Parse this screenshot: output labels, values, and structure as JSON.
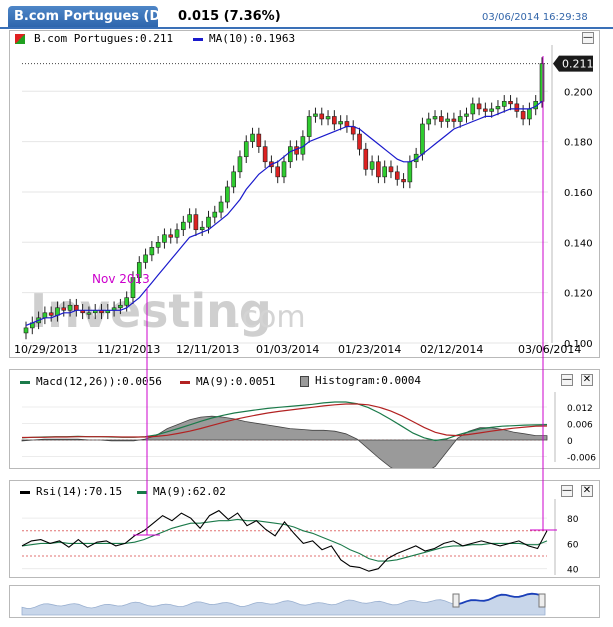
{
  "header": {
    "title": "B.com Portugues (Di...",
    "price_change": "0.015 (7.36%)",
    "timestamp": "03/06/2014 16:29:38"
  },
  "main_legend": {
    "price_label": "B.com Portugues:0.211",
    "ma_label": "MA(10):0.1963",
    "price_color": "#22aa22",
    "ma_color": "#1a1acc"
  },
  "last_price_tag": "0.211",
  "annotation": "Nov 2013",
  "watermark": {
    "brand": "Investing",
    "suffix": ".com"
  },
  "macd_legend": {
    "macd_label": "Macd(12,26)):0.0056",
    "ma_label": "MA(9):0.0051",
    "hist_label": "Histogram:0.0004",
    "macd_color": "#1b7a4a",
    "ma_color": "#b22222"
  },
  "rsi_legend": {
    "rsi_label": "Rsi(14):70.15",
    "ma_label": "MA(9):62.02",
    "rsi_color": "#000000",
    "ma_color": "#1b7a4a"
  },
  "controls": {
    "minimize": "—",
    "close": "✕"
  },
  "chart_data": [
    {
      "type": "candlestick",
      "title": "B.com Portugues",
      "x": [
        "10/29/2013",
        "11/21/2013",
        "12/11/2013",
        "01/03/2014",
        "01/23/2014",
        "02/12/2014",
        "03/06/2014"
      ],
      "y_ticks": [
        "0.100",
        "0.120",
        "0.140",
        "0.160",
        "0.180",
        "0.200"
      ],
      "ylim": [
        0.1,
        0.216
      ],
      "grid": "horizontal",
      "close": [
        0.106,
        0.108,
        0.11,
        0.112,
        0.111,
        0.114,
        0.113,
        0.115,
        0.113,
        0.112,
        0.112,
        0.113,
        0.112,
        0.113,
        0.114,
        0.115,
        0.118,
        0.126,
        0.132,
        0.135,
        0.138,
        0.14,
        0.143,
        0.142,
        0.145,
        0.148,
        0.151,
        0.145,
        0.146,
        0.15,
        0.152,
        0.156,
        0.162,
        0.168,
        0.174,
        0.18,
        0.183,
        0.178,
        0.172,
        0.17,
        0.166,
        0.172,
        0.178,
        0.175,
        0.182,
        0.19,
        0.191,
        0.189,
        0.19,
        0.187,
        0.188,
        0.186,
        0.183,
        0.177,
        0.169,
        0.172,
        0.166,
        0.17,
        0.168,
        0.165,
        0.164,
        0.172,
        0.175,
        0.187,
        0.189,
        0.19,
        0.188,
        0.189,
        0.188,
        0.19,
        0.191,
        0.195,
        0.193,
        0.192,
        0.193,
        0.194,
        0.196,
        0.195,
        0.192,
        0.189,
        0.193,
        0.196,
        0.211
      ],
      "ma10": [
        0.107,
        0.108,
        0.109,
        0.11,
        0.11,
        0.111,
        0.112,
        0.112,
        0.113,
        0.113,
        0.113,
        0.113,
        0.113,
        0.113,
        0.113,
        0.113,
        0.114,
        0.116,
        0.118,
        0.121,
        0.124,
        0.127,
        0.13,
        0.133,
        0.136,
        0.139,
        0.142,
        0.143,
        0.144,
        0.145,
        0.147,
        0.149,
        0.151,
        0.154,
        0.157,
        0.161,
        0.164,
        0.167,
        0.169,
        0.171,
        0.172,
        0.174,
        0.176,
        0.177,
        0.178,
        0.18,
        0.181,
        0.182,
        0.183,
        0.184,
        0.185,
        0.186,
        0.186,
        0.185,
        0.183,
        0.181,
        0.179,
        0.177,
        0.175,
        0.173,
        0.172,
        0.172,
        0.173,
        0.175,
        0.177,
        0.179,
        0.181,
        0.183,
        0.185,
        0.186,
        0.187,
        0.188,
        0.189,
        0.19,
        0.19,
        0.191,
        0.192,
        0.193,
        0.193,
        0.193,
        0.193,
        0.194,
        0.196
      ],
      "series": [
        {
          "name": "B.com Portugues",
          "last": 0.211
        },
        {
          "name": "MA(10)",
          "last": 0.1963
        }
      ]
    },
    {
      "type": "line",
      "title": "MACD",
      "y_ticks": [
        "0.012",
        "0.006",
        "0",
        "-0.006"
      ],
      "ylim": [
        -0.008,
        0.016
      ],
      "macd": [
        0.0008,
        0.001,
        0.0011,
        0.0012,
        0.0012,
        0.0013,
        0.0012,
        0.0012,
        0.0011,
        0.001,
        0.001,
        0.0012,
        0.0018,
        0.003,
        0.0042,
        0.0055,
        0.0068,
        0.008,
        0.009,
        0.0098,
        0.0104,
        0.011,
        0.0115,
        0.0119,
        0.0122,
        0.0126,
        0.013,
        0.0135,
        0.0138,
        0.0138,
        0.0132,
        0.0118,
        0.0098,
        0.0075,
        0.005,
        0.0025,
        0.0008,
        -0.0002,
        0.0004,
        0.0018,
        0.003,
        0.004,
        0.0046,
        0.005,
        0.0052,
        0.0054,
        0.0055,
        0.0056
      ],
      "signal": [
        0.0009,
        0.001,
        0.001,
        0.0011,
        0.0011,
        0.0012,
        0.0012,
        0.0012,
        0.0012,
        0.0011,
        0.0011,
        0.0011,
        0.0013,
        0.0017,
        0.0024,
        0.0032,
        0.0042,
        0.0053,
        0.0064,
        0.0074,
        0.0083,
        0.0091,
        0.0098,
        0.0104,
        0.0109,
        0.0114,
        0.0119,
        0.0124,
        0.0128,
        0.0131,
        0.0131,
        0.0128,
        0.0119,
        0.0106,
        0.0088,
        0.0067,
        0.0046,
        0.0028,
        0.0018,
        0.0016,
        0.002,
        0.0026,
        0.0032,
        0.0038,
        0.0043,
        0.0047,
        0.005,
        0.0051
      ],
      "series": [
        {
          "name": "Macd(12,26))",
          "last": 0.0056
        },
        {
          "name": "MA(9)",
          "last": 0.0051
        },
        {
          "name": "Histogram",
          "last": 0.0004
        }
      ]
    },
    {
      "type": "line",
      "title": "RSI",
      "y_ticks": [
        "80",
        "60",
        "40"
      ],
      "ylim": [
        35,
        92
      ],
      "reference_lines": [
        70,
        50
      ],
      "rsi": [
        58,
        62,
        63,
        60,
        62,
        57,
        63,
        57,
        61,
        62,
        58,
        60,
        66,
        70,
        76,
        82,
        78,
        84,
        80,
        72,
        82,
        86,
        79,
        84,
        74,
        78,
        71,
        66,
        77,
        68,
        60,
        62,
        55,
        58,
        47,
        42,
        41,
        38,
        40,
        48,
        52,
        55,
        58,
        54,
        56,
        60,
        62,
        58,
        60,
        62,
        60,
        58,
        60,
        62,
        58,
        56,
        70
      ],
      "rsi_ma": [
        58,
        59,
        60,
        60,
        61,
        60,
        60,
        60,
        60,
        60,
        60,
        60,
        61,
        63,
        66,
        69,
        72,
        74,
        76,
        76,
        77,
        78,
        78,
        79,
        78,
        78,
        77,
        76,
        75,
        73,
        70,
        68,
        65,
        62,
        59,
        55,
        52,
        48,
        46,
        46,
        47,
        49,
        51,
        53,
        55,
        57,
        58,
        58,
        59,
        59,
        60,
        60,
        60,
        60,
        59,
        59,
        62
      ],
      "series": [
        {
          "name": "Rsi(14)",
          "last": 70.15
        },
        {
          "name": "MA(9)",
          "last": 62.02
        }
      ]
    }
  ]
}
